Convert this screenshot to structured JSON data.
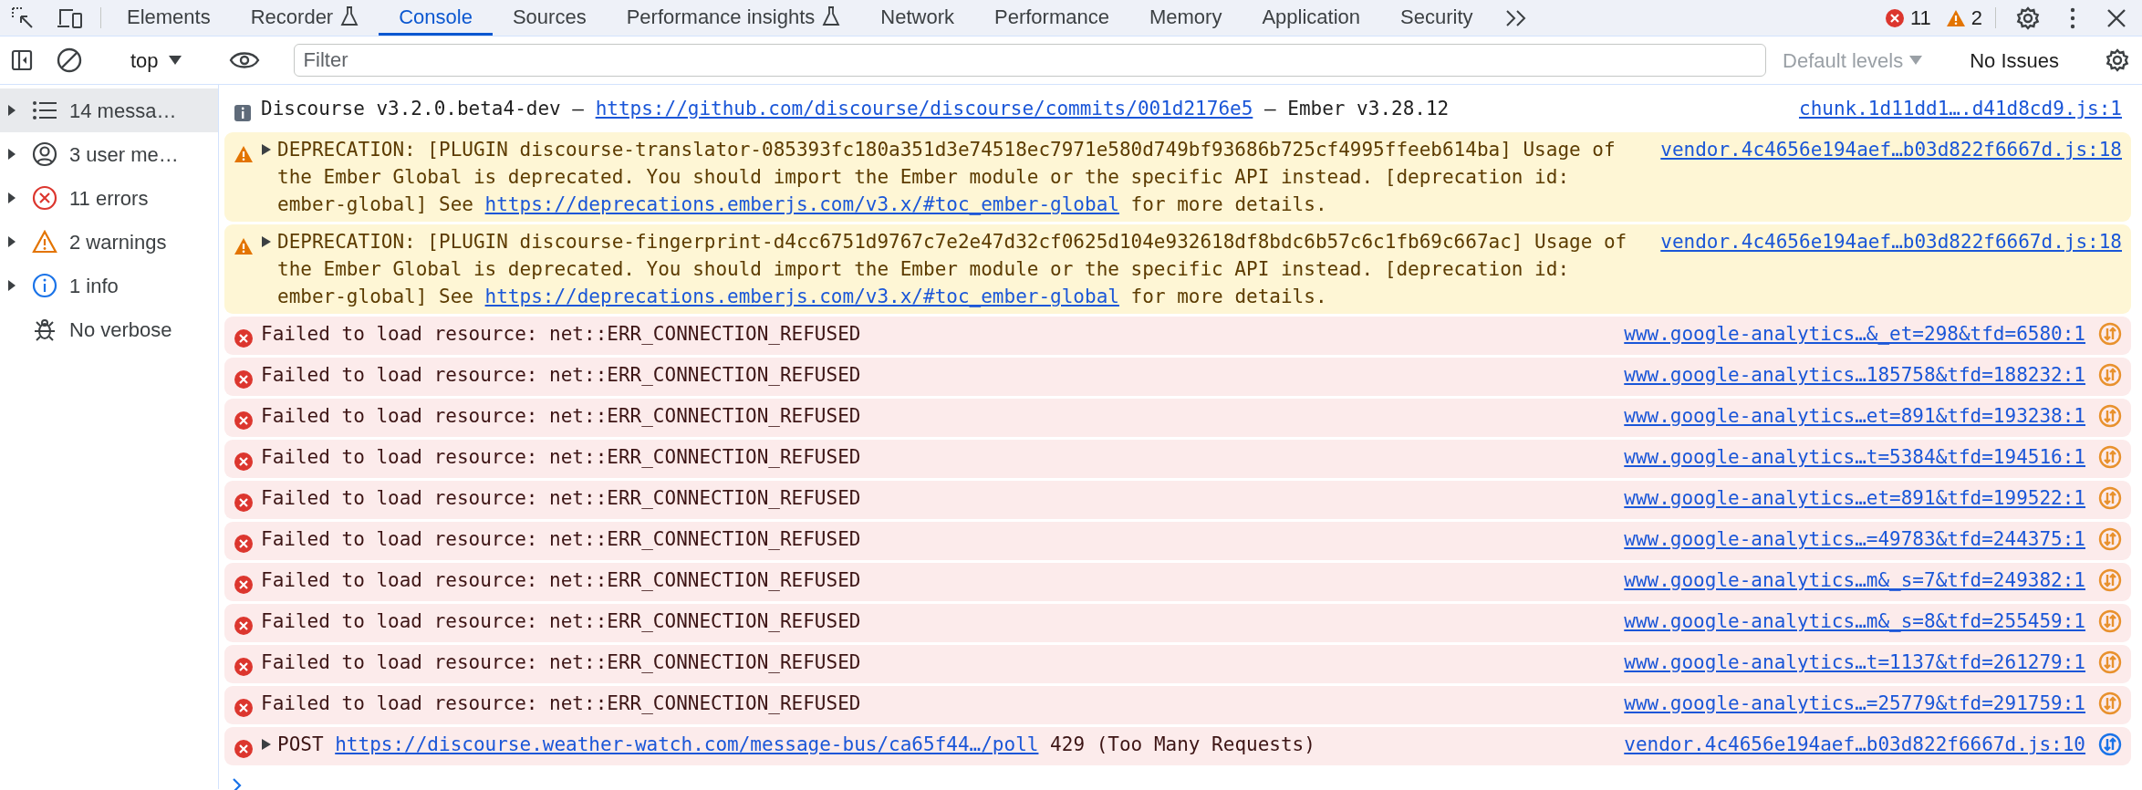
{
  "tabs": [
    {
      "label": "Elements",
      "selected": false,
      "experimental": false
    },
    {
      "label": "Recorder",
      "selected": false,
      "experimental": true
    },
    {
      "label": "Console",
      "selected": true,
      "experimental": false
    },
    {
      "label": "Sources",
      "selected": false,
      "experimental": false
    },
    {
      "label": "Performance insights",
      "selected": false,
      "experimental": true
    },
    {
      "label": "Network",
      "selected": false,
      "experimental": false
    },
    {
      "label": "Performance",
      "selected": false,
      "experimental": false
    },
    {
      "label": "Memory",
      "selected": false,
      "experimental": false
    },
    {
      "label": "Application",
      "selected": false,
      "experimental": false
    },
    {
      "label": "Security",
      "selected": false,
      "experimental": false
    }
  ],
  "error_count": "11",
  "warning_count": "2",
  "toolbar": {
    "context": "top",
    "filter": {
      "placeholder": "Filter"
    },
    "levels": "Default levels",
    "levels_disabled": true,
    "issues": "No Issues"
  },
  "sidebar": {
    "items": [
      {
        "kind": "all",
        "label": "14 messa…",
        "selected": true,
        "expandable": true
      },
      {
        "kind": "user",
        "label": "3 user me…",
        "selected": false,
        "expandable": true
      },
      {
        "kind": "error",
        "label": "11 errors",
        "selected": false,
        "expandable": true
      },
      {
        "kind": "warning",
        "label": "2 warnings",
        "selected": false,
        "expandable": true
      },
      {
        "kind": "info",
        "label": "1 info",
        "selected": false,
        "expandable": true
      },
      {
        "kind": "verbose",
        "label": "No verbose",
        "selected": false,
        "expandable": false
      }
    ]
  },
  "messages": [
    {
      "kind": "info",
      "expandable": false,
      "parts": [
        {
          "kind": "text",
          "text": "Discourse v3.2.0.beta4-dev – "
        },
        {
          "kind": "link",
          "text": "https://github.com/discourse/discourse/commits/001d2176e5"
        },
        {
          "kind": "text",
          "text": " – Ember v3.28.12"
        }
      ],
      "source": "chunk.1d11dd1….d41d8cd9.js:1"
    },
    {
      "kind": "warning",
      "expandable": true,
      "parts": [
        {
          "kind": "text",
          "text": "DEPRECATION: [PLUGIN discourse-translator-085393fc180a351d3e74518ec7971e580d749bf93686b725cf4995ffeeb614ba] Usage of the Ember Global is deprecated. You should import the Ember module or the specific API instead. [deprecation id: ember-global] See "
        },
        {
          "kind": "link",
          "text": "https://deprecations.emberjs.com/v3.x/#toc_ember-global"
        },
        {
          "kind": "text",
          "text": " for more details."
        }
      ],
      "source": "vendor.4c4656e194aef…b03d822f6667d.js:18"
    },
    {
      "kind": "warning",
      "expandable": true,
      "parts": [
        {
          "kind": "text",
          "text": "DEPRECATION: [PLUGIN discourse-fingerprint-d4cc6751d9767c7e2e47d32cf0625d104e932618df8bdc6b57c6c1fb69c667ac] Usage of the Ember Global is deprecated. You should import the Ember module or the specific API instead. [deprecation id: ember-global] See "
        },
        {
          "kind": "link",
          "text": "https://deprecations.emberjs.com/v3.x/#toc_ember-global"
        },
        {
          "kind": "text",
          "text": " for more details."
        }
      ],
      "source": "vendor.4c4656e194aef…b03d822f6667d.js:18"
    },
    {
      "kind": "error",
      "expandable": false,
      "parts": [
        {
          "kind": "text",
          "text": "Failed to load resource: net::ERR_CONNECTION_REFUSED"
        }
      ],
      "source": "www.google-analytics…&_et=298&tfd=6580:1",
      "request_warning": true
    },
    {
      "kind": "error",
      "expandable": false,
      "parts": [
        {
          "kind": "text",
          "text": "Failed to load resource: net::ERR_CONNECTION_REFUSED"
        }
      ],
      "source": "www.google-analytics…185758&tfd=188232:1",
      "request_warning": true
    },
    {
      "kind": "error",
      "expandable": false,
      "parts": [
        {
          "kind": "text",
          "text": "Failed to load resource: net::ERR_CONNECTION_REFUSED"
        }
      ],
      "source": "www.google-analytics…et=891&tfd=193238:1",
      "request_warning": true
    },
    {
      "kind": "error",
      "expandable": false,
      "parts": [
        {
          "kind": "text",
          "text": "Failed to load resource: net::ERR_CONNECTION_REFUSED"
        }
      ],
      "source": "www.google-analytics…t=5384&tfd=194516:1",
      "request_warning": true
    },
    {
      "kind": "error",
      "expandable": false,
      "parts": [
        {
          "kind": "text",
          "text": "Failed to load resource: net::ERR_CONNECTION_REFUSED"
        }
      ],
      "source": "www.google-analytics…et=891&tfd=199522:1",
      "request_warning": true
    },
    {
      "kind": "error",
      "expandable": false,
      "parts": [
        {
          "kind": "text",
          "text": "Failed to load resource: net::ERR_CONNECTION_REFUSED"
        }
      ],
      "source": "www.google-analytics…=49783&tfd=244375:1",
      "request_warning": true
    },
    {
      "kind": "error",
      "expandable": false,
      "parts": [
        {
          "kind": "text",
          "text": "Failed to load resource: net::ERR_CONNECTION_REFUSED"
        }
      ],
      "source": "www.google-analytics…m&_s=7&tfd=249382:1",
      "request_warning": true
    },
    {
      "kind": "error",
      "expandable": false,
      "parts": [
        {
          "kind": "text",
          "text": "Failed to load resource: net::ERR_CONNECTION_REFUSED"
        }
      ],
      "source": "www.google-analytics…m&_s=8&tfd=255459:1",
      "request_warning": true
    },
    {
      "kind": "error",
      "expandable": false,
      "parts": [
        {
          "kind": "text",
          "text": "Failed to load resource: net::ERR_CONNECTION_REFUSED"
        }
      ],
      "source": "www.google-analytics…t=1137&tfd=261279:1",
      "request_warning": true
    },
    {
      "kind": "error",
      "expandable": false,
      "parts": [
        {
          "kind": "text",
          "text": "Failed to load resource: net::ERR_CONNECTION_REFUSED"
        }
      ],
      "source": "www.google-analytics…=25779&tfd=291759:1",
      "request_warning": true
    },
    {
      "kind": "error",
      "expandable": true,
      "parts": [
        {
          "kind": "text",
          "text": "POST "
        },
        {
          "kind": "link",
          "text": "https://discourse.weather-watch.com/message-bus/ca65f44…/poll"
        },
        {
          "kind": "text",
          "text": " 429 (Too Many Requests)"
        }
      ],
      "source": "vendor.4c4656e194aef…b03d822f6667d.js:10",
      "request_warning": false
    }
  ]
}
